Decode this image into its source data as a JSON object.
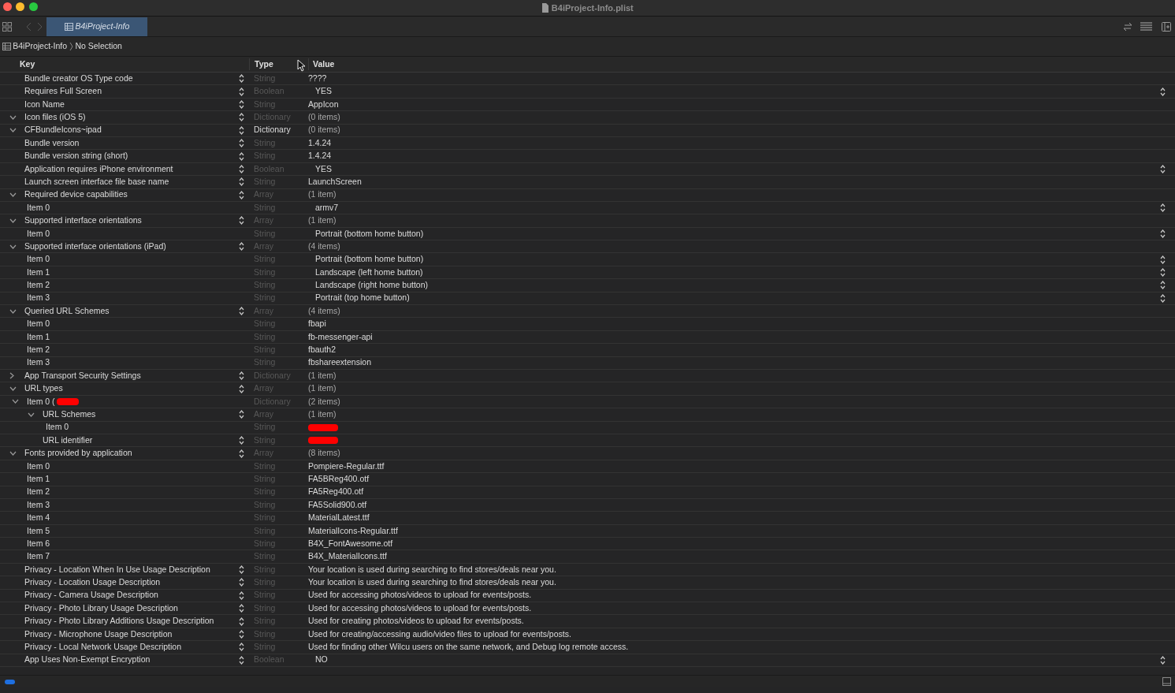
{
  "window": {
    "title": "B4iProject-Info.plist"
  },
  "tabs": [
    {
      "label": "B4iProject-Info",
      "selected": true
    }
  ],
  "breadcrumb": [
    "B4iProject-Info",
    "No Selection"
  ],
  "columns": [
    "Key",
    "Type",
    "Value"
  ],
  "rows": [
    {
      "kind": "text",
      "key": "Bundle creator OS Type code",
      "type": "String",
      "type_dim": true,
      "value": "????",
      "stepper": true
    },
    {
      "kind": "choice",
      "key": "Requires Full Screen",
      "type": "Boolean",
      "type_dim": true,
      "value": "YES",
      "stepper": true
    },
    {
      "kind": "text",
      "key": "Icon Name",
      "type": "String",
      "type_dim": true,
      "value": "AppIcon",
      "stepper": true
    },
    {
      "kind": "group",
      "key": "Icon files (iOS 5)",
      "type": "Dictionary",
      "type_dim": true,
      "value": "(0 items)",
      "stepper": true,
      "expanded": true
    },
    {
      "kind": "group",
      "key": "CFBundleIcons~ipad",
      "type": "Dictionary",
      "type_dim": false,
      "value": "(0 items)",
      "stepper": true,
      "expanded": true
    },
    {
      "kind": "text",
      "key": "Bundle version",
      "type": "String",
      "type_dim": true,
      "value": "1.4.24",
      "stepper": true
    },
    {
      "kind": "text",
      "key": "Bundle version string (short)",
      "type": "String",
      "type_dim": true,
      "value": "1.4.24",
      "stepper": true
    },
    {
      "kind": "choice",
      "key": "Application requires iPhone environment",
      "type": "Boolean",
      "type_dim": true,
      "value": "YES",
      "stepper": true
    },
    {
      "kind": "text",
      "key": "Launch screen interface file base name",
      "type": "String",
      "type_dim": true,
      "value": "LaunchScreen",
      "stepper": true
    },
    {
      "kind": "group",
      "key": "Required device capabilities",
      "type": "Array",
      "type_dim": true,
      "value": "(1 item)",
      "stepper": true,
      "expanded": true,
      "children": [
        {
          "kind": "choice",
          "key": "Item 0",
          "type": "String",
          "type_dim": true,
          "value": "armv7",
          "stepper": false
        }
      ]
    },
    {
      "kind": "group",
      "key": "Supported interface orientations",
      "type": "Array",
      "type_dim": true,
      "value": "(1 item)",
      "stepper": true,
      "expanded": true,
      "children": [
        {
          "kind": "choice",
          "key": "Item 0",
          "type": "String",
          "type_dim": true,
          "value": "Portrait (bottom home button)",
          "stepper": false
        }
      ]
    },
    {
      "kind": "group",
      "key": "Supported interface orientations (iPad)",
      "type": "Array",
      "type_dim": true,
      "value": "(4 items)",
      "stepper": true,
      "expanded": true,
      "children": [
        {
          "kind": "choice",
          "key": "Item 0",
          "type": "String",
          "type_dim": true,
          "value": "Portrait (bottom home button)",
          "stepper": false
        },
        {
          "kind": "choice",
          "key": "Item 1",
          "type": "String",
          "type_dim": true,
          "value": "Landscape (left home button)",
          "stepper": false
        },
        {
          "kind": "choice",
          "key": "Item 2",
          "type": "String",
          "type_dim": true,
          "value": "Landscape (right home button)",
          "stepper": false
        },
        {
          "kind": "choice",
          "key": "Item 3",
          "type": "String",
          "type_dim": true,
          "value": "Portrait (top home button)",
          "stepper": false
        }
      ]
    },
    {
      "kind": "group",
      "key": "Queried URL Schemes",
      "type": "Array",
      "type_dim": true,
      "value": "(4 items)",
      "stepper": true,
      "expanded": true,
      "children": [
        {
          "kind": "text",
          "key": "Item 0",
          "type": "String",
          "type_dim": true,
          "value": "fbapi",
          "stepper": false
        },
        {
          "kind": "text",
          "key": "Item 1",
          "type": "String",
          "type_dim": true,
          "value": "fb-messenger-api",
          "stepper": false
        },
        {
          "kind": "text",
          "key": "Item 2",
          "type": "String",
          "type_dim": true,
          "value": "fbauth2",
          "stepper": false
        },
        {
          "kind": "text",
          "key": "Item 3",
          "type": "String",
          "type_dim": true,
          "value": "fbshareextension",
          "stepper": false
        }
      ]
    },
    {
      "kind": "group",
      "key": "App Transport Security Settings",
      "type": "Dictionary",
      "type_dim": true,
      "value": "(1 item)",
      "stepper": true,
      "expanded": false
    },
    {
      "kind": "group",
      "key": "URL types",
      "type": "Array",
      "type_dim": true,
      "value": "(1 item)",
      "stepper": true,
      "expanded": true,
      "children": [
        {
          "kind": "group",
          "key": "Item 0 (",
          "key_redacted": true,
          "type": "Dictionary",
          "type_dim": true,
          "value": "(2 items)",
          "stepper": false,
          "expanded": true,
          "children": [
            {
              "kind": "group",
              "key": "URL Schemes",
              "type": "Array",
              "type_dim": true,
              "value": "(1 item)",
              "stepper": true,
              "expanded": true,
              "children": [
                {
                  "kind": "text",
                  "key": "Item 0",
                  "type": "String",
                  "type_dim": true,
                  "value_redacted": true,
                  "stepper": false
                }
              ]
            },
            {
              "kind": "text",
              "key": "URL identifier",
              "type": "String",
              "type_dim": true,
              "value_redacted": true,
              "stepper": true
            }
          ]
        }
      ]
    },
    {
      "kind": "group",
      "key": "Fonts provided by application",
      "type": "Array",
      "type_dim": true,
      "value": "(8 items)",
      "stepper": true,
      "expanded": true,
      "children": [
        {
          "kind": "text",
          "key": "Item 0",
          "type": "String",
          "type_dim": true,
          "value": "Pompiere-Regular.ttf",
          "stepper": false
        },
        {
          "kind": "text",
          "key": "Item 1",
          "type": "String",
          "type_dim": true,
          "value": "FA5BReg400.otf",
          "stepper": false
        },
        {
          "kind": "text",
          "key": "Item 2",
          "type": "String",
          "type_dim": true,
          "value": "FA5Reg400.otf",
          "stepper": false
        },
        {
          "kind": "text",
          "key": "Item 3",
          "type": "String",
          "type_dim": true,
          "value": "FA5Solid900.otf",
          "stepper": false
        },
        {
          "kind": "text",
          "key": "Item 4",
          "type": "String",
          "type_dim": true,
          "value": "MaterialLatest.ttf",
          "stepper": false
        },
        {
          "kind": "text",
          "key": "Item 5",
          "type": "String",
          "type_dim": true,
          "value": "MaterialIcons-Regular.ttf",
          "stepper": false
        },
        {
          "kind": "text",
          "key": "Item 6",
          "type": "String",
          "type_dim": true,
          "value": "B4X_FontAwesome.otf",
          "stepper": false
        },
        {
          "kind": "text",
          "key": "Item 7",
          "type": "String",
          "type_dim": true,
          "value": "B4X_MaterialIcons.ttf",
          "stepper": false
        }
      ]
    },
    {
      "kind": "text",
      "key": "Privacy - Location When In Use Usage Description",
      "type": "String",
      "type_dim": true,
      "value": "Your location is used during searching to find stores/deals near you.",
      "stepper": true
    },
    {
      "kind": "text",
      "key": "Privacy - Location Usage Description",
      "type": "String",
      "type_dim": true,
      "value": "Your location is used during searching to find stores/deals near you.",
      "stepper": true
    },
    {
      "kind": "text",
      "key": "Privacy - Camera Usage Description",
      "type": "String",
      "type_dim": true,
      "value": "Used for accessing photos/videos to upload for events/posts.",
      "stepper": true
    },
    {
      "kind": "text",
      "key": "Privacy - Photo Library Usage Description",
      "type": "String",
      "type_dim": true,
      "value": "Used for accessing photos/videos to upload for events/posts.",
      "stepper": true
    },
    {
      "kind": "text",
      "key": "Privacy - Photo Library Additions Usage Description",
      "type": "String",
      "type_dim": true,
      "value": "Used for creating photos/videos to upload for events/posts.",
      "stepper": true
    },
    {
      "kind": "text",
      "key": "Privacy - Microphone Usage Description",
      "type": "String",
      "type_dim": true,
      "value": "Used for creating/accessing audio/video files to upload for events/posts.",
      "stepper": true
    },
    {
      "kind": "text",
      "key": "Privacy - Local Network Usage Description",
      "type": "String",
      "type_dim": true,
      "value": "Used for finding other Wilcu users on the same network, and Debug log remote access.",
      "stepper": true
    },
    {
      "kind": "choice",
      "key": "App Uses Non-Exempt Encryption",
      "type": "Boolean",
      "type_dim": true,
      "value": "NO",
      "stepper": true
    }
  ]
}
